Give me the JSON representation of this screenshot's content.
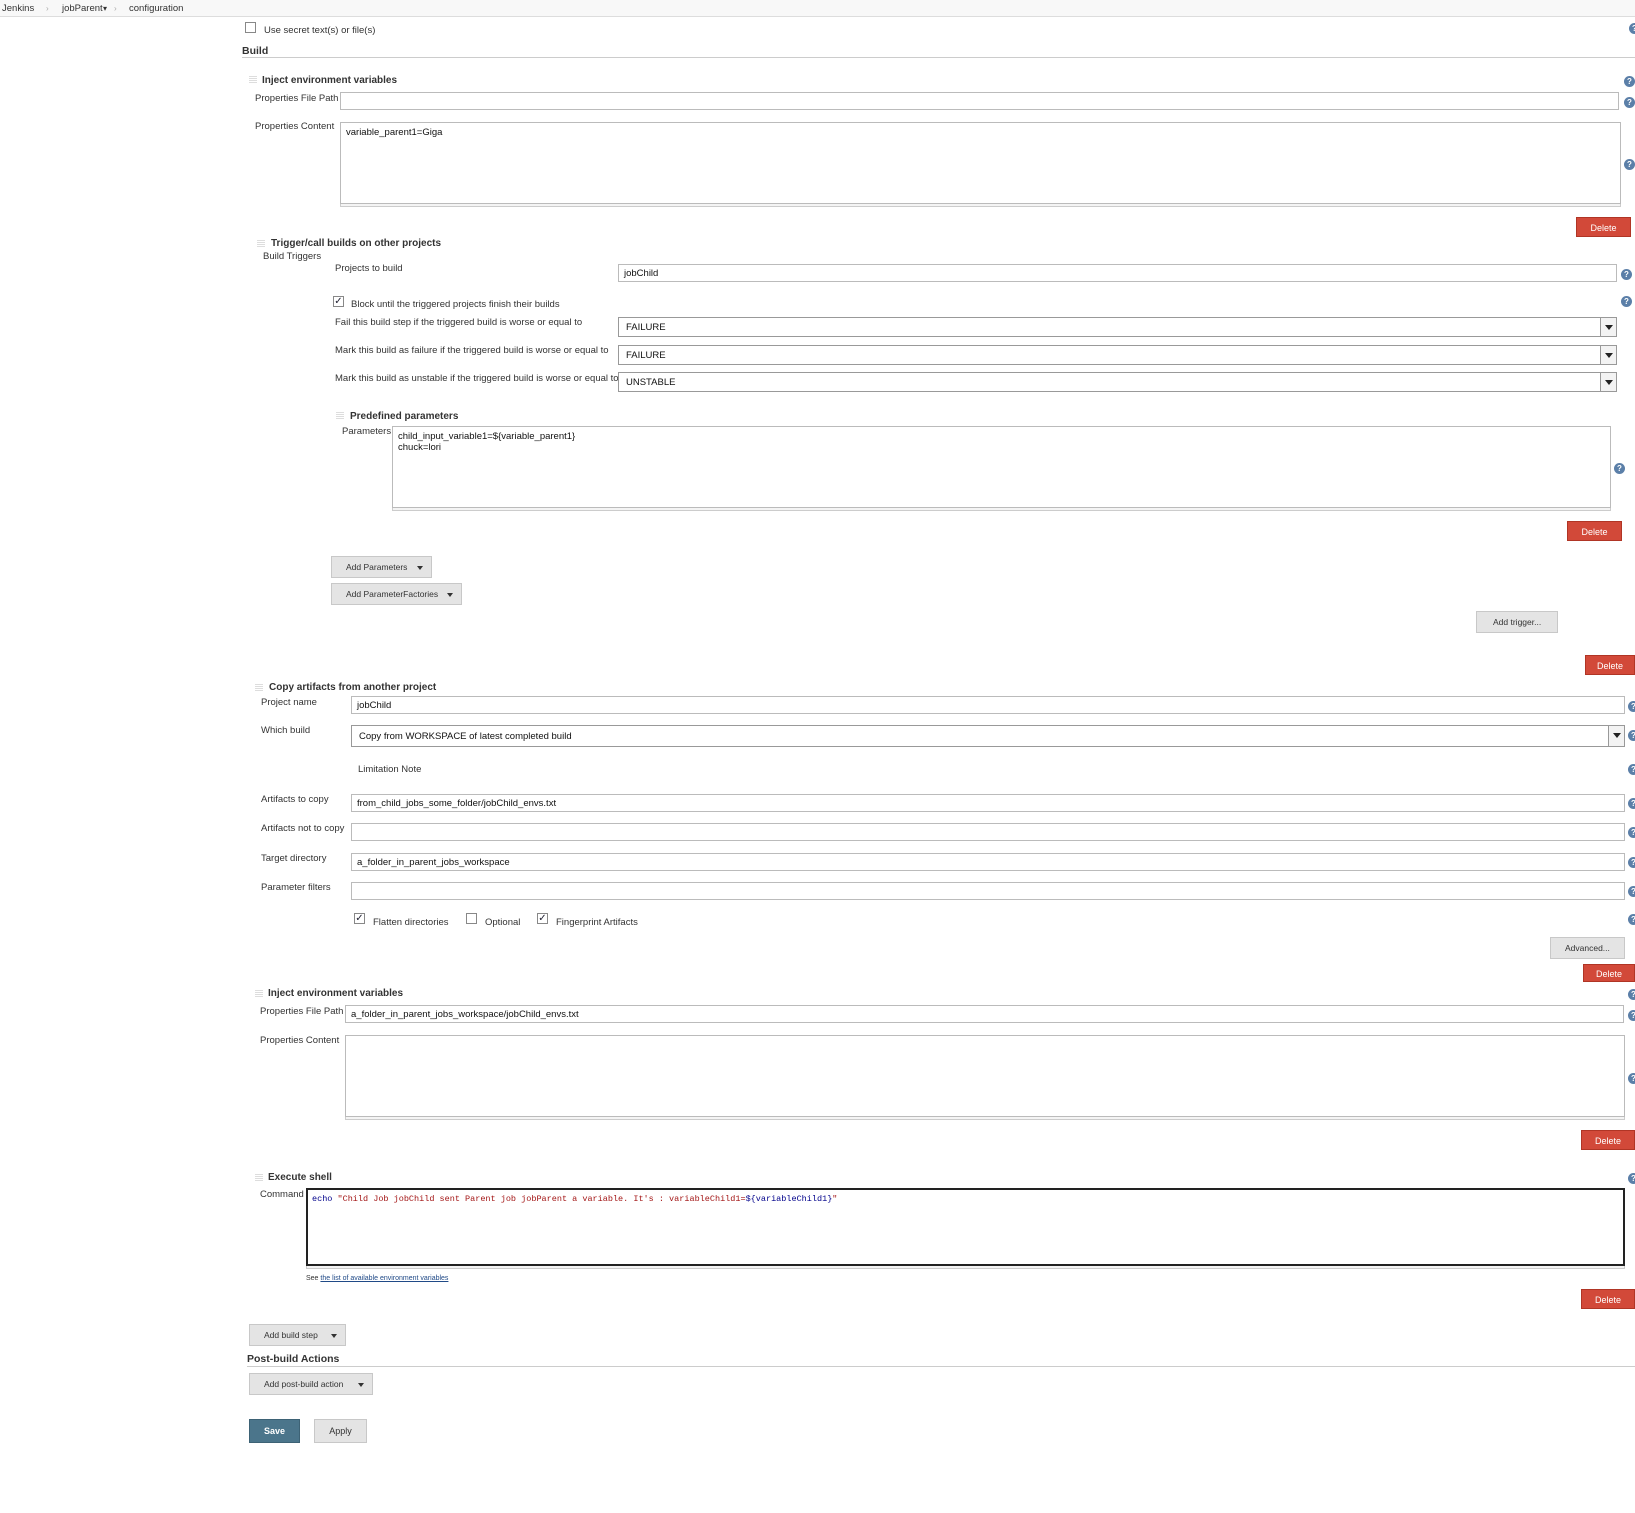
{
  "breadcrumb": {
    "items": [
      "Jenkins",
      "jobParent",
      "configuration"
    ],
    "separator": "›",
    "dropdown_glyph": "▾"
  },
  "secret": {
    "label": "Use secret text(s) or file(s)",
    "checked": false
  },
  "build_section": {
    "title": "Build"
  },
  "inject1": {
    "title": "Inject environment variables",
    "path_label": "Properties File Path",
    "path_value": "",
    "content_label": "Properties Content",
    "content_value": "variable_parent1=Giga",
    "delete_label": "Delete"
  },
  "trigger": {
    "title": "Trigger/call builds on other projects",
    "build_triggers_label": "Build Triggers",
    "projects_label": "Projects to build",
    "projects_value": "jobChild",
    "block_label": "Block until the triggered projects finish their builds",
    "block_checked": true,
    "fail_step_label": "Fail this build step if the triggered build is worse or equal to",
    "fail_step_value": "FAILURE",
    "mark_failure_label": "Mark this build as failure if the triggered build is worse or equal to",
    "mark_failure_value": "FAILURE",
    "mark_unstable_label": "Mark this build as unstable if the triggered build is worse or equal to",
    "mark_unstable_value": "UNSTABLE",
    "predefined_title": "Predefined parameters",
    "parameters_label": "Parameters",
    "parameters_value": "child_input_variable1=${variable_parent1}\nchuck=lori",
    "predefined_delete_label": "Delete",
    "add_parameters_label": "Add Parameters",
    "add_parameter_factories_label": "Add ParameterFactories",
    "add_trigger_label": "Add trigger...",
    "delete_label": "Delete"
  },
  "copy": {
    "title": "Copy artifacts from another project",
    "project_label": "Project name",
    "project_value": "jobChild",
    "which_label": "Which build",
    "which_value": "Copy from WORKSPACE of latest completed build",
    "limitation_note": "Limitation Note",
    "artifacts_label": "Artifacts to copy",
    "artifacts_value": "from_child_jobs_some_folder/jobChild_envs.txt",
    "not_copy_label": "Artifacts not to copy",
    "not_copy_value": "",
    "target_label": "Target directory",
    "target_value": "a_folder_in_parent_jobs_workspace",
    "filters_label": "Parameter filters",
    "filters_value": "",
    "flatten_label": "Flatten directories",
    "flatten_checked": true,
    "optional_label": "Optional",
    "optional_checked": false,
    "fingerprint_label": "Fingerprint Artifacts",
    "fingerprint_checked": true,
    "advanced_label": "Advanced...",
    "delete_label": "Delete"
  },
  "inject2": {
    "title": "Inject environment variables",
    "path_label": "Properties File Path",
    "path_value": "a_folder_in_parent_jobs_workspace/jobChild_envs.txt",
    "content_label": "Properties Content",
    "content_value": "",
    "delete_label": "Delete"
  },
  "shell": {
    "title": "Execute shell",
    "command_label": "Command",
    "cmd_echo": "echo",
    "cmd_string": " \"Child Job jobChild sent Parent job jobParent a variable. It's : variableChild1=",
    "cmd_var": "${variableChild1}",
    "cmd_end": "\"",
    "see_text": "See",
    "see_link": "the list of available environment variables",
    "delete_label": "Delete"
  },
  "add_build_step_label": "Add build step",
  "post_build": {
    "title": "Post-build Actions",
    "add_label": "Add post-build action"
  },
  "actions": {
    "save_label": "Save",
    "apply_label": "Apply"
  },
  "help_glyph": "?",
  "check_glyph": "✓",
  "colors": {
    "delete": "#d24939",
    "save": "#4b758b",
    "help": "#5b7fa8"
  }
}
